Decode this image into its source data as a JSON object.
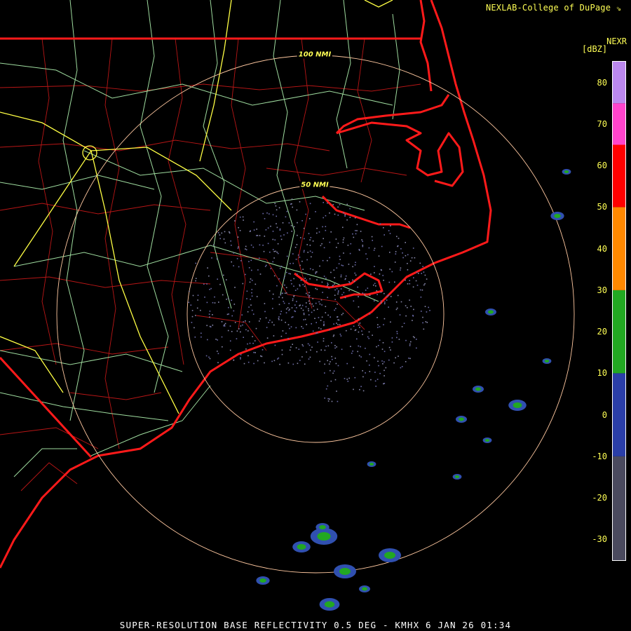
{
  "header": {
    "credit": "NEXLAB-College of DuPage ⇘",
    "product": "NEXR",
    "unit": "[dBZ]"
  },
  "range_rings": [
    {
      "label": "50 NMI"
    },
    {
      "label": "100 NMI"
    }
  ],
  "legend": {
    "ticks": [
      "80",
      "70",
      "60",
      "50",
      "40",
      "30",
      "20",
      "10",
      "0",
      "-10",
      "-20",
      "-30"
    ],
    "range_dbz": [
      -35,
      85
    ],
    "bands": [
      {
        "from": -35,
        "to": -10,
        "color": "#4a4a5e"
      },
      {
        "from": -10,
        "to": 10,
        "color": "#2a3ea8"
      },
      {
        "from": 10,
        "to": 30,
        "color": "#22a822"
      },
      {
        "from": 30,
        "to": 50,
        "color": "#ff8800"
      },
      {
        "from": 50,
        "to": 65,
        "color": "#ff0000"
      },
      {
        "from": 65,
        "to": 75,
        "color": "#ff44cc"
      },
      {
        "from": 75,
        "to": 85,
        "color": "#bb88ee"
      }
    ]
  },
  "footer": {
    "caption": "SUPER-RESOLUTION BASE REFLECTIVITY 0.5 DEG - KMHX 6 JAN 26 01:34"
  },
  "colors": {
    "background": "#000000",
    "coast_state": "#ff2020",
    "county": "#c01818",
    "highway": "#9fdc9f",
    "interstate": "#ffff44",
    "range_ring": "#ffc8a0",
    "label": "#ffff55"
  }
}
